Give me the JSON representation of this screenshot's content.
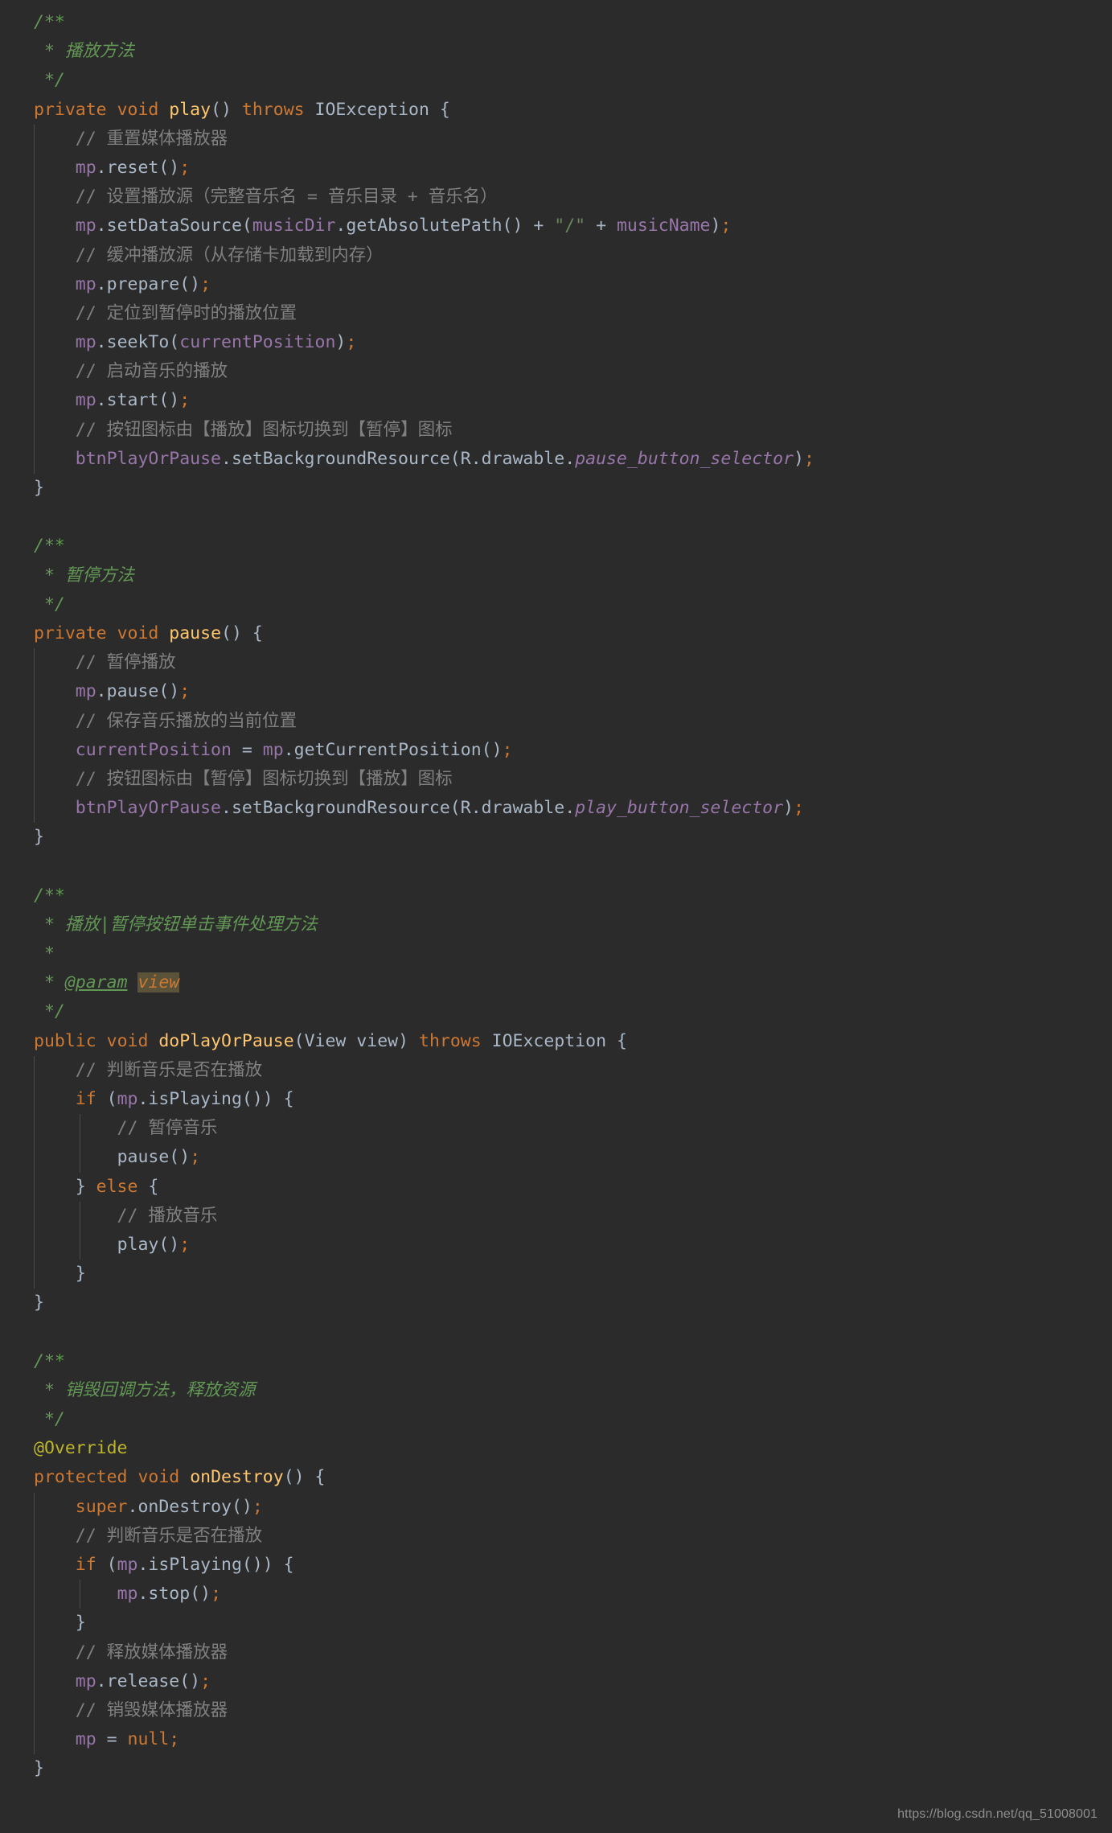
{
  "editor": {
    "theme": "darcula",
    "background": "#2b2b2b",
    "language": "java",
    "colors": {
      "keyword": "#cc7832",
      "method_declaration": "#ffc66d",
      "annotation": "#bbb529",
      "field": "#9876aa",
      "string": "#6a8759",
      "line_comment": "#808080",
      "javadoc": "#629755",
      "default_text": "#a9b7c6",
      "param_highlight_bg": "#5b5339",
      "indent_guide": "#4b4b4b"
    },
    "lines": [
      {
        "id": 1,
        "indent": 0,
        "text": "/**"
      },
      {
        "id": 2,
        "indent": 0,
        "text": " * 播放方法"
      },
      {
        "id": 3,
        "indent": 0,
        "text": " */"
      },
      {
        "id": 4,
        "indent": 0,
        "text": "private void play() throws IOException {"
      },
      {
        "id": 5,
        "indent": 1,
        "text": "// 重置媒体播放器"
      },
      {
        "id": 6,
        "indent": 1,
        "text": "mp.reset();"
      },
      {
        "id": 7,
        "indent": 1,
        "text": "// 设置播放源（完整音乐名 = 音乐目录 + 音乐名）"
      },
      {
        "id": 8,
        "indent": 1,
        "text": "mp.setDataSource(musicDir.getAbsolutePath() + \"/\" + musicName);"
      },
      {
        "id": 9,
        "indent": 1,
        "text": "// 缓冲播放源（从存储卡加载到内存）"
      },
      {
        "id": 10,
        "indent": 1,
        "text": "mp.prepare();"
      },
      {
        "id": 11,
        "indent": 1,
        "text": "// 定位到暂停时的播放位置"
      },
      {
        "id": 12,
        "indent": 1,
        "text": "mp.seekTo(currentPosition);"
      },
      {
        "id": 13,
        "indent": 1,
        "text": "// 启动音乐的播放"
      },
      {
        "id": 14,
        "indent": 1,
        "text": "mp.start();"
      },
      {
        "id": 15,
        "indent": 1,
        "text": "// 按钮图标由【播放】图标切换到【暂停】图标"
      },
      {
        "id": 16,
        "indent": 1,
        "text": "btnPlayOrPause.setBackgroundResource(R.drawable.pause_button_selector);"
      },
      {
        "id": 17,
        "indent": 0,
        "text": "}"
      },
      {
        "id": 18,
        "indent": 0,
        "text": ""
      },
      {
        "id": 19,
        "indent": 0,
        "text": "/**"
      },
      {
        "id": 20,
        "indent": 0,
        "text": " * 暂停方法"
      },
      {
        "id": 21,
        "indent": 0,
        "text": " */"
      },
      {
        "id": 22,
        "indent": 0,
        "text": "private void pause() {"
      },
      {
        "id": 23,
        "indent": 1,
        "text": "// 暂停播放"
      },
      {
        "id": 24,
        "indent": 1,
        "text": "mp.pause();"
      },
      {
        "id": 25,
        "indent": 1,
        "text": "// 保存音乐播放的当前位置"
      },
      {
        "id": 26,
        "indent": 1,
        "text": "currentPosition = mp.getCurrentPosition();"
      },
      {
        "id": 27,
        "indent": 1,
        "text": "// 按钮图标由【暂停】图标切换到【播放】图标"
      },
      {
        "id": 28,
        "indent": 1,
        "text": "btnPlayOrPause.setBackgroundResource(R.drawable.play_button_selector);"
      },
      {
        "id": 29,
        "indent": 0,
        "text": "}"
      },
      {
        "id": 30,
        "indent": 0,
        "text": ""
      },
      {
        "id": 31,
        "indent": 0,
        "text": "/**"
      },
      {
        "id": 32,
        "indent": 0,
        "text": " * 播放|暂停按钮单击事件处理方法"
      },
      {
        "id": 33,
        "indent": 0,
        "text": " *"
      },
      {
        "id": 34,
        "indent": 0,
        "text": " * @param view"
      },
      {
        "id": 35,
        "indent": 0,
        "text": " */"
      },
      {
        "id": 36,
        "indent": 0,
        "text": "public void doPlayOrPause(View view) throws IOException {"
      },
      {
        "id": 37,
        "indent": 1,
        "text": "// 判断音乐是否在播放"
      },
      {
        "id": 38,
        "indent": 1,
        "text": "if (mp.isPlaying()) {"
      },
      {
        "id": 39,
        "indent": 2,
        "text": "// 暂停音乐"
      },
      {
        "id": 40,
        "indent": 2,
        "text": "pause();"
      },
      {
        "id": 41,
        "indent": 1,
        "text": "} else {"
      },
      {
        "id": 42,
        "indent": 2,
        "text": "// 播放音乐"
      },
      {
        "id": 43,
        "indent": 2,
        "text": "play();"
      },
      {
        "id": 44,
        "indent": 1,
        "text": "}"
      },
      {
        "id": 45,
        "indent": 0,
        "text": "}"
      },
      {
        "id": 46,
        "indent": 0,
        "text": ""
      },
      {
        "id": 47,
        "indent": 0,
        "text": "/**"
      },
      {
        "id": 48,
        "indent": 0,
        "text": " * 销毁回调方法，释放资源"
      },
      {
        "id": 49,
        "indent": 0,
        "text": " */"
      },
      {
        "id": 50,
        "indent": 0,
        "text": "@Override"
      },
      {
        "id": 51,
        "indent": 0,
        "text": "protected void onDestroy() {"
      },
      {
        "id": 52,
        "indent": 1,
        "text": "super.onDestroy();"
      },
      {
        "id": 53,
        "indent": 1,
        "text": "// 判断音乐是否在播放"
      },
      {
        "id": 54,
        "indent": 1,
        "text": "if (mp.isPlaying()) {"
      },
      {
        "id": 55,
        "indent": 2,
        "text": "mp.stop();"
      },
      {
        "id": 56,
        "indent": 1,
        "text": "}"
      },
      {
        "id": 57,
        "indent": 1,
        "text": "// 释放媒体播放器"
      },
      {
        "id": 58,
        "indent": 1,
        "text": "mp.release();"
      },
      {
        "id": 59,
        "indent": 1,
        "text": "// 销毁媒体播放器"
      },
      {
        "id": 60,
        "indent": 1,
        "text": "mp = null;"
      },
      {
        "id": 61,
        "indent": 0,
        "text": "}"
      }
    ],
    "tokens": {
      "keywords": [
        "private",
        "public",
        "protected",
        "void",
        "throws",
        "if",
        "else",
        "super",
        "null"
      ],
      "method_names": [
        "play",
        "pause",
        "doPlayOrPause",
        "onDestroy"
      ],
      "fields": [
        "mp",
        "currentPosition",
        "musicDir",
        "musicName",
        "btnPlayOrPause"
      ],
      "types": [
        "IOException",
        "View",
        "R"
      ],
      "annotation": "@Override",
      "string_literals": [
        "\"/\""
      ],
      "javadoc_tag": "@param",
      "javadoc_param_name": "view",
      "italic_resources": [
        "pause_button_selector",
        "play_button_selector"
      ]
    }
  },
  "watermark": {
    "text": "https://blog.csdn.net/qq_51008001"
  }
}
